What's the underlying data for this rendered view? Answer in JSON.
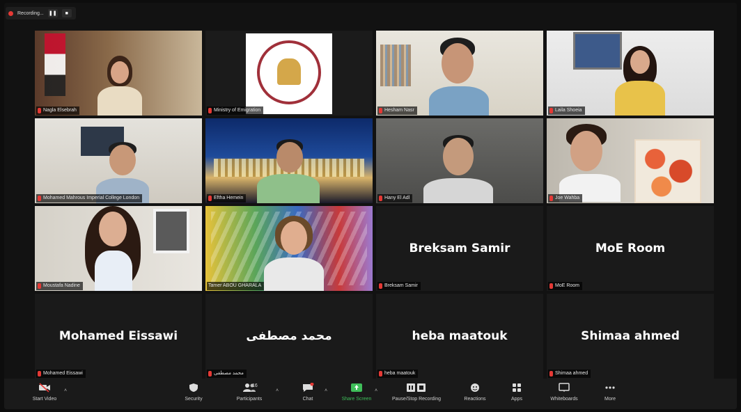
{
  "recording": {
    "label": "Recording..."
  },
  "tiles": [
    {
      "name": "Nagla Elsebrah"
    },
    {
      "name": "Ministry of Emigration"
    },
    {
      "name": "Hesham Nasr"
    },
    {
      "name": "Laila Shoeia"
    },
    {
      "name": "Mohamed Mahrous Imperial College London"
    },
    {
      "name": "Eftha Hemein"
    },
    {
      "name": "Hany El Adl"
    },
    {
      "name": "Joe Wahba"
    },
    {
      "name": "Moustafa Nadine"
    },
    {
      "name": "Tamer ABOU GHARALA"
    },
    {
      "name": "Breksam Samir",
      "display": "Breksam Samir"
    },
    {
      "name": "MoE Room",
      "display": "MoE Room"
    },
    {
      "name": "Mohamed Eissawi",
      "display": "Mohamed Eissawi"
    },
    {
      "name": "محمد مصطفى",
      "display": "محمد مصطفى"
    },
    {
      "name": "heba maatouk",
      "display": "heba maatouk"
    },
    {
      "name": "Shimaa ahmed",
      "display": "Shimaa ahmed"
    }
  ],
  "toolbar": {
    "start_video": "Start Video",
    "security": "Security",
    "participants": "Participants",
    "participants_count": "16",
    "chat": "Chat",
    "share_screen": "Share Screen",
    "pause_recording": "Pause/Stop Recording",
    "reactions": "Reactions",
    "apps": "Apps",
    "whiteboards": "Whiteboards",
    "more": "More"
  },
  "colors": {
    "active_speaker": "#c6d94a",
    "share_green": "#3fbf5a",
    "mute_red": "#e53935"
  }
}
